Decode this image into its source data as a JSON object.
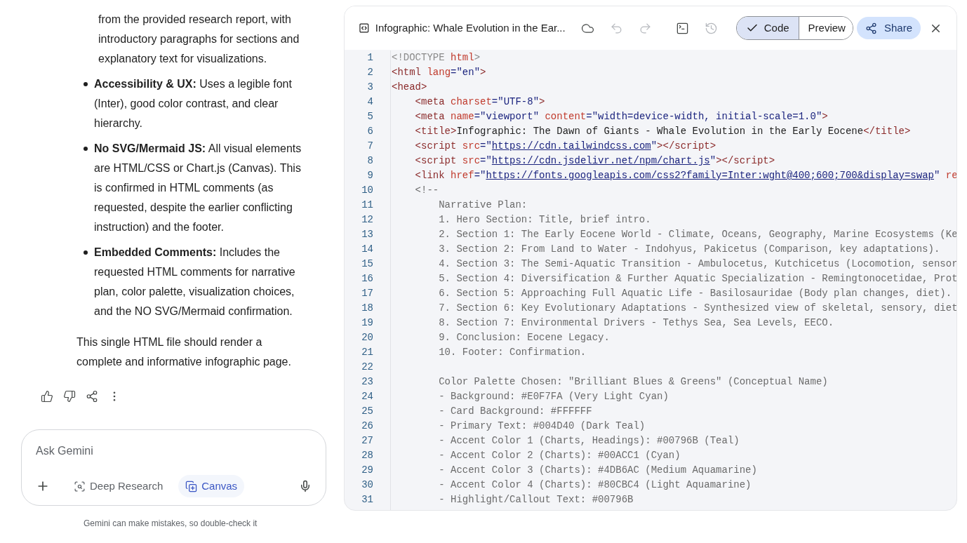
{
  "chat": {
    "paragraphs": [
      {
        "kind": "continuation",
        "text": "from the provided research report, with introductory paragraphs for sections and explanatory text for visualizations."
      },
      {
        "kind": "bullet",
        "text": "**Accessibility & UX:** Uses a legible font (Inter), good color contrast, and clear hierarchy."
      },
      {
        "kind": "bullet",
        "text": "**No SVG/Mermaid JS:** All visual elements are HTML/CSS or Chart.js (Canvas). This is confirmed in HTML comments (as requested, despite the earlier conflicting instruction) and the footer."
      },
      {
        "kind": "bullet",
        "text": "**Embedded Comments:** Includes the requested HTML comments for narrative plan, color palette, visualization choices, and the NO SVG/Mermaid confirmation."
      },
      {
        "kind": "plain",
        "text": "This single HTML file should render a complete and informative infographic page."
      }
    ],
    "actions": [
      {
        "kind": "like"
      },
      {
        "kind": "dislike"
      },
      {
        "kind": "share"
      },
      {
        "kind": "more"
      }
    ],
    "input": {
      "placeholder": "Ask Gemini",
      "tools": [
        {
          "kind": "research",
          "label": "Deep Research",
          "selected": false
        },
        {
          "kind": "canvas",
          "label": "Canvas",
          "selected": true
        }
      ]
    },
    "disclaimer": "Gemini can make mistakes, so double-check it"
  },
  "editor": {
    "title": "Infographic: Whale Evolution in the Ear...",
    "toolbar": [
      {
        "kind": "cloud",
        "disabled": false
      },
      {
        "kind": "undo",
        "disabled": true
      },
      {
        "kind": "redo",
        "disabled": true
      },
      {
        "kind": "terminal",
        "disabled": false
      },
      {
        "kind": "history",
        "disabled": true
      }
    ],
    "views": [
      {
        "label": "Code",
        "selected": true
      },
      {
        "label": "Preview",
        "selected": false
      }
    ],
    "share": "Share",
    "lines": [
      {
        "number": "1",
        "tokens": [
          {
            "kind": "doctype",
            "text": "<!DOCTYPE "
          },
          {
            "kind": "attr",
            "text": "html"
          },
          {
            "kind": "doctype",
            "text": ">"
          }
        ]
      },
      {
        "number": "2",
        "tokens": [
          {
            "kind": "tag",
            "text": "<html "
          },
          {
            "kind": "attr",
            "text": "lang"
          },
          {
            "kind": "str",
            "text": "=\"en\""
          },
          {
            "kind": "tag",
            "text": ">"
          }
        ]
      },
      {
        "number": "3",
        "tokens": [
          {
            "kind": "tag",
            "text": "<head>"
          }
        ]
      },
      {
        "number": "4",
        "tokens": [
          {
            "kind": "tag",
            "text": "    <meta "
          },
          {
            "kind": "attr",
            "text": "charset"
          },
          {
            "kind": "str",
            "text": "=\"UTF-8\""
          },
          {
            "kind": "tag",
            "text": ">"
          }
        ]
      },
      {
        "number": "5",
        "tokens": [
          {
            "kind": "tag",
            "text": "    <meta "
          },
          {
            "kind": "attr",
            "text": "name"
          },
          {
            "kind": "str",
            "text": "=\"viewport\" "
          },
          {
            "kind": "attr",
            "text": "content"
          },
          {
            "kind": "str",
            "text": "=\"width=device-width, initial-scale=1.0\""
          },
          {
            "kind": "tag",
            "text": ">"
          }
        ]
      },
      {
        "number": "6",
        "tokens": [
          {
            "kind": "tag",
            "text": "    <title>"
          },
          {
            "kind": "text",
            "text": "Infographic: The Dawn of Giants - Whale Evolution in the Early Eocene"
          },
          {
            "kind": "tag",
            "text": "</title>"
          }
        ]
      },
      {
        "number": "7",
        "tokens": [
          {
            "kind": "tag",
            "text": "    <script "
          },
          {
            "kind": "attr",
            "text": "src"
          },
          {
            "kind": "str",
            "text": "=\""
          },
          {
            "kind": "link",
            "text": "https://cdn.tailwindcss.com"
          },
          {
            "kind": "str",
            "text": "\""
          },
          {
            "kind": "tag",
            "text": "></script>"
          }
        ]
      },
      {
        "number": "8",
        "tokens": [
          {
            "kind": "tag",
            "text": "    <script "
          },
          {
            "kind": "attr",
            "text": "src"
          },
          {
            "kind": "str",
            "text": "=\""
          },
          {
            "kind": "link",
            "text": "https://cdn.jsdelivr.net/npm/chart.js"
          },
          {
            "kind": "str",
            "text": "\""
          },
          {
            "kind": "tag",
            "text": "></script>"
          }
        ]
      },
      {
        "number": "9",
        "tokens": [
          {
            "kind": "tag",
            "text": "    <link "
          },
          {
            "kind": "attr",
            "text": "href"
          },
          {
            "kind": "str",
            "text": "=\""
          },
          {
            "kind": "link",
            "text": "https://fonts.googleapis.com/css2?family=Inter:wght@400;600;700&display=swap"
          },
          {
            "kind": "str",
            "text": "\" "
          },
          {
            "kind": "attr",
            "text": "re"
          }
        ]
      },
      {
        "number": "10",
        "tokens": [
          {
            "kind": "comment",
            "text": "    <!--"
          }
        ]
      },
      {
        "number": "11",
        "tokens": [
          {
            "kind": "comment",
            "text": "        Narrative Plan:"
          }
        ]
      },
      {
        "number": "12",
        "tokens": [
          {
            "kind": "comment",
            "text": "        1. Hero Section: Title, brief intro."
          }
        ]
      },
      {
        "number": "13",
        "tokens": [
          {
            "kind": "comment",
            "text": "        2. Section 1: The Early Eocene World - Climate, Oceans, Geography, Marine Ecosystems (Ke"
          }
        ]
      },
      {
        "number": "14",
        "tokens": [
          {
            "kind": "comment",
            "text": "        3. Section 2: From Land to Water - Indohyus, Pakicetus (Comparison, key adaptations)."
          }
        ]
      },
      {
        "number": "15",
        "tokens": [
          {
            "kind": "comment",
            "text": "        4. Section 3: The Semi-Aquatic Transition - Ambulocetus, Kutchicetus (Locomotion, sensor"
          }
        ]
      },
      {
        "number": "16",
        "tokens": [
          {
            "kind": "comment",
            "text": "        5. Section 4: Diversification & Further Aquatic Specialization - Remingtonocetidae, Prot"
          }
        ]
      },
      {
        "number": "17",
        "tokens": [
          {
            "kind": "comment",
            "text": "        6. Section 5: Approaching Full Aquatic Life - Basilosauridae (Body plan changes, diet)."
          }
        ]
      },
      {
        "number": "18",
        "tokens": [
          {
            "kind": "comment",
            "text": "        7. Section 6: Key Evolutionary Adaptations - Synthesized view of skeletal, sensory, diet"
          }
        ]
      },
      {
        "number": "19",
        "tokens": [
          {
            "kind": "comment",
            "text": "        8. Section 7: Environmental Drivers - Tethys Sea, Sea Levels, EECO."
          }
        ]
      },
      {
        "number": "20",
        "tokens": [
          {
            "kind": "comment",
            "text": "        9. Conclusion: Eocene Legacy."
          }
        ]
      },
      {
        "number": "21",
        "tokens": [
          {
            "kind": "comment",
            "text": "        10. Footer: Confirmation."
          }
        ]
      },
      {
        "number": "22"
      },
      {
        "number": "23",
        "tokens": [
          {
            "kind": "comment",
            "text": "        Color Palette Chosen: \"Brilliant Blues & Greens\" (Conceptual Name)"
          }
        ]
      },
      {
        "number": "24",
        "tokens": [
          {
            "kind": "comment",
            "text": "        - Background: #E0F7FA (Very Light Cyan)"
          }
        ]
      },
      {
        "number": "25",
        "tokens": [
          {
            "kind": "comment",
            "text": "        - Card Background: #FFFFFF"
          }
        ]
      },
      {
        "number": "26",
        "tokens": [
          {
            "kind": "comment",
            "text": "        - Primary Text: #004D40 (Dark Teal)"
          }
        ]
      },
      {
        "number": "27",
        "tokens": [
          {
            "kind": "comment",
            "text": "        - Accent Color 1 (Charts, Headings): #00796B (Teal)"
          }
        ]
      },
      {
        "number": "28",
        "tokens": [
          {
            "kind": "comment",
            "text": "        - Accent Color 2 (Charts): #00ACC1 (Cyan)"
          }
        ]
      },
      {
        "number": "29",
        "tokens": [
          {
            "kind": "comment",
            "text": "        - Accent Color 3 (Charts): #4DB6AC (Medium Aquamarine)"
          }
        ]
      },
      {
        "number": "30",
        "tokens": [
          {
            "kind": "comment",
            "text": "        - Accent Color 4 (Charts): #80CBC4 (Light Aquamarine)"
          }
        ]
      },
      {
        "number": "31",
        "tokens": [
          {
            "kind": "comment",
            "text": "        - Highlight/Callout Text: #00796B"
          }
        ]
      }
    ]
  }
}
